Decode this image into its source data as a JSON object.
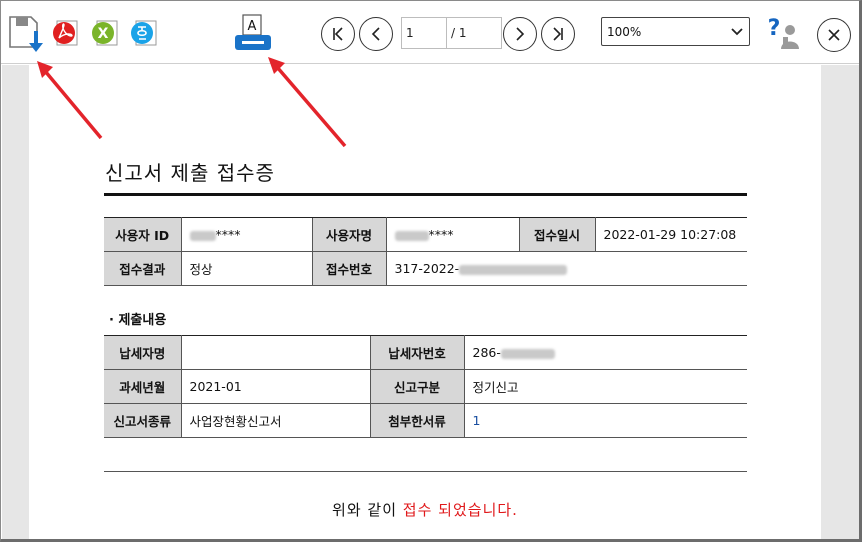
{
  "toolbar": {
    "page_current": "1",
    "page_total": "/ 1",
    "zoom": "100%",
    "print_glyph": "A"
  },
  "document": {
    "title": "신고서 제출 접수증",
    "receipt": {
      "user_id_label": "사용자 ID",
      "user_id_value": "****",
      "user_name_label": "사용자명",
      "user_name_value": "****",
      "received_at_label": "접수일시",
      "received_at_value": "2022-01-29 10:27:08",
      "result_label": "접수결과",
      "result_value": "정상",
      "receipt_no_label": "접수번호",
      "receipt_no_value": "317-2022-"
    },
    "section_title": "· 제출내용",
    "submission": {
      "taxpayer_name_label": "납세자명",
      "taxpayer_name_value": "",
      "taxpayer_no_label": "납세자번호",
      "taxpayer_no_value": "286-",
      "tax_period_label": "과세년월",
      "tax_period_value": "2021-01",
      "report_type_label": "신고구분",
      "report_type_value": "정기신고",
      "report_kind_label": "신고서종류",
      "report_kind_value": "사업장현황신고서",
      "attachments_label": "첨부한서류",
      "attachments_value": "1"
    },
    "message_prefix": "위와 같이 ",
    "message_highlight": "접수 되었습니다."
  },
  "colors": {
    "accent_blue": "#1a73c8",
    "pdf_red": "#e02020",
    "excel_green": "#7ab42a",
    "hwp_blue": "#1aa3e8",
    "arrow_red": "#e3242b",
    "help_blue": "#1565c0"
  }
}
